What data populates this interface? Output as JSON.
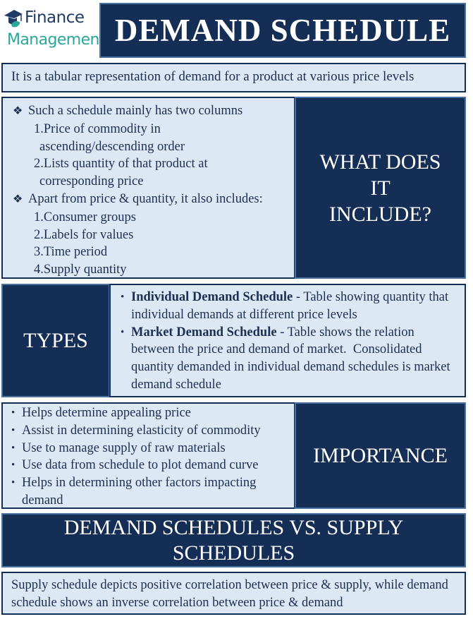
{
  "logo": {
    "icon": "graduation-cap-e-icon",
    "line1": "Finance",
    "line2": "Management",
    "colors": {
      "line1": "#1f3b66",
      "line2": "#2aa79b"
    }
  },
  "title": "DEMAND SCHEDULE",
  "definition": "It is a tabular representation of demand for a product at various price levels",
  "includes": {
    "heading": "WHAT DOES IT INCLUDE?",
    "groups": [
      {
        "bullet_icon": "diamond-bullet-icon",
        "text": "Such a schedule mainly has two columns",
        "items": [
          {
            "num": "1.",
            "line1": "Price of commodity in",
            "line2": "ascending/descending order"
          },
          {
            "num": "2.",
            "line1": "Lists quantity of that product at",
            "line2": "corresponding price"
          }
        ]
      },
      {
        "bullet_icon": "diamond-bullet-icon",
        "text": "Apart from price & quantity, it also includes:",
        "items": [
          {
            "num": "1.",
            "line1": "Consumer groups"
          },
          {
            "num": "2.",
            "line1": "Labels for values"
          },
          {
            "num": "3.",
            "line1": "Time period"
          },
          {
            "num": "4.",
            "line1": "Supply quantity"
          }
        ]
      }
    ]
  },
  "types": {
    "heading": "TYPES",
    "items": [
      {
        "term": "Individual Demand Schedule",
        "desc": " - Table showing quantity that individual demands at different price levels"
      },
      {
        "term": "Market Demand Schedule",
        "desc": " - Table shows the relation between the price and demand of market.  Consolidated quantity demanded in individual demand schedules is market demand schedule"
      }
    ]
  },
  "importance": {
    "heading": "IMPORTANCE",
    "items": [
      "Helps determine appealing price",
      "Assist in determining elasticity of commodity",
      "Use to manage supply of raw materials",
      "Use data from schedule to plot demand curve",
      "Helps in determining other factors impacting demand"
    ]
  },
  "comparison": {
    "heading": "DEMAND SCHEDULES VS. SUPPLY SCHEDULES",
    "body": "Supply schedule depicts positive correlation between price & supply, while demand schedule shows an inverse correlation between price & demand"
  },
  "colors": {
    "navy": "#152e55",
    "steel_border": "#4a72a0",
    "light_panel": "#dde8f5",
    "text": "#1d2f52"
  }
}
